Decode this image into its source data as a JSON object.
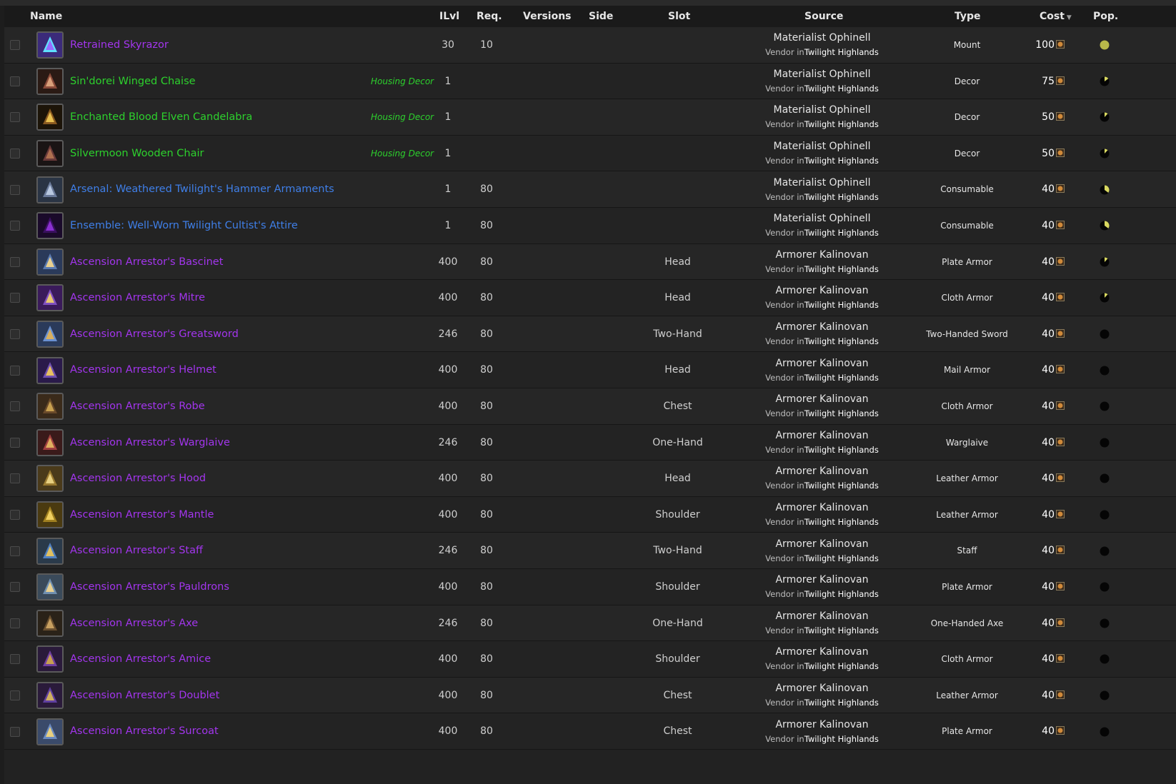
{
  "columns": {
    "name": "Name",
    "ilvl": "ILvl",
    "req": "Req.",
    "versions": "Versions",
    "side": "Side",
    "slot": "Slot",
    "source": "Source",
    "type": "Type",
    "cost": "Cost",
    "pop": "Pop."
  },
  "rows": [
    {
      "name": "Retrained Skyrazor",
      "quality": "epic",
      "tag": "",
      "ilvl": "30",
      "req": "10",
      "slot": "",
      "npc": "Materialist Ophinell",
      "vendor_prefix": "Vendor in",
      "zone": "Twilight Highlands",
      "type": "Mount",
      "cost": "100",
      "icon": "skyrazor-mount-icon",
      "pop": 1.0,
      "pop_color": "#b9b94a"
    },
    {
      "name": "Sin'dorei Winged Chaise",
      "quality": "green",
      "tag": "Housing Decor",
      "ilvl": "1",
      "req": "",
      "slot": "",
      "npc": "Materialist Ophinell",
      "vendor_prefix": "Vendor in",
      "zone": "Twilight Highlands",
      "type": "Decor",
      "cost": "75",
      "icon": "chaise-icon",
      "pop": 0.15,
      "pop_color": "#d8d860"
    },
    {
      "name": "Enchanted Blood Elven Candelabra",
      "quality": "green",
      "tag": "Housing Decor",
      "ilvl": "1",
      "req": "",
      "slot": "",
      "npc": "Materialist Ophinell",
      "vendor_prefix": "Vendor in",
      "zone": "Twilight Highlands",
      "type": "Decor",
      "cost": "50",
      "icon": "candelabra-icon",
      "pop": 0.12,
      "pop_color": "#d8d860"
    },
    {
      "name": "Silvermoon Wooden Chair",
      "quality": "green",
      "tag": "Housing Decor",
      "ilvl": "1",
      "req": "",
      "slot": "",
      "npc": "Materialist Ophinell",
      "vendor_prefix": "Vendor in",
      "zone": "Twilight Highlands",
      "type": "Decor",
      "cost": "50",
      "icon": "wooden-chair-icon",
      "pop": 0.12,
      "pop_color": "#d8d860"
    },
    {
      "name": "Arsenal: Weathered Twilight's Hammer Armaments",
      "quality": "rare",
      "tag": "",
      "ilvl": "1",
      "req": "80",
      "slot": "",
      "npc": "Materialist Ophinell",
      "vendor_prefix": "Vendor in",
      "zone": "Twilight Highlands",
      "type": "Consumable",
      "cost": "40",
      "icon": "arsenal-weapons-icon",
      "pop": 0.35,
      "pop_color": "#d8d860"
    },
    {
      "name": "Ensemble: Well-Worn Twilight Cultist's Attire",
      "quality": "rare",
      "tag": "",
      "ilvl": "1",
      "req": "80",
      "slot": "",
      "npc": "Materialist Ophinell",
      "vendor_prefix": "Vendor in",
      "zone": "Twilight Highlands",
      "type": "Consumable",
      "cost": "40",
      "icon": "cultist-hood-icon",
      "pop": 0.35,
      "pop_color": "#d8d860"
    },
    {
      "name": "Ascension Arrestor's Bascinet",
      "quality": "epic",
      "tag": "",
      "ilvl": "400",
      "req": "80",
      "slot": "Head",
      "npc": "Armorer Kalinovan",
      "vendor_prefix": "Vendor in",
      "zone": "Twilight Highlands",
      "type": "Plate Armor",
      "cost": "40",
      "icon": "plate-helm-icon",
      "pop": 0.12,
      "pop_color": "#d8d860"
    },
    {
      "name": "Ascension Arrestor's Mitre",
      "quality": "epic",
      "tag": "",
      "ilvl": "400",
      "req": "80",
      "slot": "Head",
      "npc": "Armorer Kalinovan",
      "vendor_prefix": "Vendor in",
      "zone": "Twilight Highlands",
      "type": "Cloth Armor",
      "cost": "40",
      "icon": "mitre-icon",
      "pop": 0.12,
      "pop_color": "#d8d860"
    },
    {
      "name": "Ascension Arrestor's Greatsword",
      "quality": "epic",
      "tag": "",
      "ilvl": "246",
      "req": "80",
      "slot": "Two-Hand",
      "npc": "Armorer Kalinovan",
      "vendor_prefix": "Vendor in",
      "zone": "Twilight Highlands",
      "type": "Two-Handed Sword",
      "cost": "40",
      "icon": "greatsword-icon",
      "pop": 0,
      "pop_color": "#d8d860"
    },
    {
      "name": "Ascension Arrestor's Helmet",
      "quality": "epic",
      "tag": "",
      "ilvl": "400",
      "req": "80",
      "slot": "Head",
      "npc": "Armorer Kalinovan",
      "vendor_prefix": "Vendor in",
      "zone": "Twilight Highlands",
      "type": "Mail Armor",
      "cost": "40",
      "icon": "mail-helm-icon",
      "pop": 0,
      "pop_color": "#d8d860"
    },
    {
      "name": "Ascension Arrestor's Robe",
      "quality": "epic",
      "tag": "",
      "ilvl": "400",
      "req": "80",
      "slot": "Chest",
      "npc": "Armorer Kalinovan",
      "vendor_prefix": "Vendor in",
      "zone": "Twilight Highlands",
      "type": "Cloth Armor",
      "cost": "40",
      "icon": "robe-icon",
      "pop": 0,
      "pop_color": "#d8d860"
    },
    {
      "name": "Ascension Arrestor's Warglaive",
      "quality": "epic",
      "tag": "",
      "ilvl": "246",
      "req": "80",
      "slot": "One-Hand",
      "npc": "Armorer Kalinovan",
      "vendor_prefix": "Vendor in",
      "zone": "Twilight Highlands",
      "type": "Warglaive",
      "cost": "40",
      "icon": "warglaive-icon",
      "pop": 0,
      "pop_color": "#d8d860"
    },
    {
      "name": "Ascension Arrestor's Hood",
      "quality": "epic",
      "tag": "",
      "ilvl": "400",
      "req": "80",
      "slot": "Head",
      "npc": "Armorer Kalinovan",
      "vendor_prefix": "Vendor in",
      "zone": "Twilight Highlands",
      "type": "Leather Armor",
      "cost": "40",
      "icon": "leather-hood-icon",
      "pop": 0,
      "pop_color": "#d8d860"
    },
    {
      "name": "Ascension Arrestor's Mantle",
      "quality": "epic",
      "tag": "",
      "ilvl": "400",
      "req": "80",
      "slot": "Shoulder",
      "npc": "Armorer Kalinovan",
      "vendor_prefix": "Vendor in",
      "zone": "Twilight Highlands",
      "type": "Leather Armor",
      "cost": "40",
      "icon": "mantle-icon",
      "pop": 0,
      "pop_color": "#d8d860"
    },
    {
      "name": "Ascension Arrestor's Staff",
      "quality": "epic",
      "tag": "",
      "ilvl": "246",
      "req": "80",
      "slot": "Two-Hand",
      "npc": "Armorer Kalinovan",
      "vendor_prefix": "Vendor in",
      "zone": "Twilight Highlands",
      "type": "Staff",
      "cost": "40",
      "icon": "staff-icon",
      "pop": 0,
      "pop_color": "#d8d860"
    },
    {
      "name": "Ascension Arrestor's Pauldrons",
      "quality": "epic",
      "tag": "",
      "ilvl": "400",
      "req": "80",
      "slot": "Shoulder",
      "npc": "Armorer Kalinovan",
      "vendor_prefix": "Vendor in",
      "zone": "Twilight Highlands",
      "type": "Plate Armor",
      "cost": "40",
      "icon": "pauldrons-icon",
      "pop": 0,
      "pop_color": "#d8d860"
    },
    {
      "name": "Ascension Arrestor's Axe",
      "quality": "epic",
      "tag": "",
      "ilvl": "246",
      "req": "80",
      "slot": "One-Hand",
      "npc": "Armorer Kalinovan",
      "vendor_prefix": "Vendor in",
      "zone": "Twilight Highlands",
      "type": "One-Handed Axe",
      "cost": "40",
      "icon": "axe-icon",
      "pop": 0,
      "pop_color": "#d8d860"
    },
    {
      "name": "Ascension Arrestor's Amice",
      "quality": "epic",
      "tag": "",
      "ilvl": "400",
      "req": "80",
      "slot": "Shoulder",
      "npc": "Armorer Kalinovan",
      "vendor_prefix": "Vendor in",
      "zone": "Twilight Highlands",
      "type": "Cloth Armor",
      "cost": "40",
      "icon": "amice-icon",
      "pop": 0,
      "pop_color": "#d8d860"
    },
    {
      "name": "Ascension Arrestor's Doublet",
      "quality": "epic",
      "tag": "",
      "ilvl": "400",
      "req": "80",
      "slot": "Chest",
      "npc": "Armorer Kalinovan",
      "vendor_prefix": "Vendor in",
      "zone": "Twilight Highlands",
      "type": "Leather Armor",
      "cost": "40",
      "icon": "doublet-icon",
      "pop": 0,
      "pop_color": "#d8d860"
    },
    {
      "name": "Ascension Arrestor's Surcoat",
      "quality": "epic",
      "tag": "",
      "ilvl": "400",
      "req": "80",
      "slot": "Chest",
      "npc": "Armorer Kalinovan",
      "vendor_prefix": "Vendor in",
      "zone": "Twilight Highlands",
      "type": "Plate Armor",
      "cost": "40",
      "icon": "surcoat-icon",
      "pop": 0,
      "pop_color": "#d8d860"
    }
  ],
  "colors": {
    "epic": "#a335ee",
    "rare": "#3f7fe8",
    "green": "#2dd12d",
    "background": "#222222",
    "header": "#1a1a1a"
  }
}
